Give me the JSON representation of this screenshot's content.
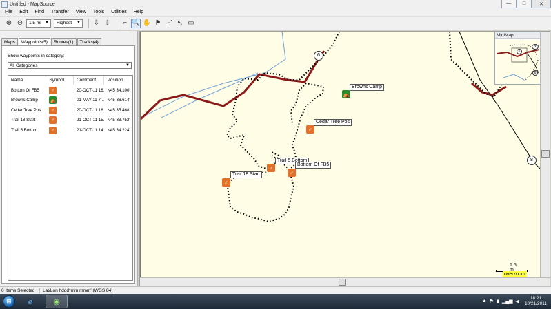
{
  "window": {
    "title": "Untitled - MapSource",
    "minimize": "—",
    "maximize": "□",
    "close": "✕"
  },
  "menu": [
    "File",
    "Edit",
    "Find",
    "Transfer",
    "View",
    "Tools",
    "Utilities",
    "Help"
  ],
  "toolbar": {
    "scale_value": "1.5 mi",
    "detail_value": "Highest"
  },
  "left_panel": {
    "tabs": [
      "Maps",
      "Waypoints(5)",
      "Routes(1)",
      "Tracks(4)"
    ],
    "active_tab": "Waypoints(5)",
    "category_label": "Show waypoints in category:",
    "category_value": "All Categories",
    "columns": [
      "Name",
      "Symbol",
      "Comment",
      "Position"
    ],
    "rows": [
      {
        "name": "Bottom Of FB5",
        "symbol": "bike-icon",
        "comment": "20-OCT-11 16...",
        "position": "N45 34.100'"
      },
      {
        "name": "Browns Camp",
        "symbol": "campground-icon",
        "comment": "01-MAY-11 7:...",
        "position": "N45 36.614'"
      },
      {
        "name": "Cedar Tree Pos",
        "symbol": "bike-icon",
        "comment": "20-OCT-11 16...",
        "position": "N45 35.468'"
      },
      {
        "name": "Trail 18 Start",
        "symbol": "bike-icon",
        "comment": "21-OCT-11 15...",
        "position": "N45 33.752'"
      },
      {
        "name": "Trail 5 Bottom",
        "symbol": "bike-icon",
        "comment": "21-OCT-11 14...",
        "position": "N45 34.224'"
      }
    ]
  },
  "map": {
    "waypoints": {
      "browns_camp": "Browns Camp",
      "cedar_tree_pos": "Cedar Tree Pos",
      "trail_5_bottom": "Trail 5 Bottom",
      "bottom_of_fb5": "Bottom Of FB5",
      "trail_18_start": "Trail 18 Start"
    },
    "road_shields": {
      "top": "6",
      "right": "8"
    },
    "minimap_title": "MiniMap",
    "minimap_shields": {
      "a": "6",
      "b": "26",
      "c": "6"
    },
    "scale_label": "1.5 mi",
    "overzoom": "overzoom"
  },
  "status": {
    "selection": "0 Items Selected",
    "format": "Lat/Lon hddd°mm.mmm' (WGS 84)"
  },
  "taskbar": {
    "time": "18:21",
    "date": "10/21/2011"
  },
  "colors": {
    "map_bg": "#fffde6",
    "road": "#8b1a1a",
    "water": "#6fa0d8",
    "bike_symbol": "#e0702a",
    "camp_symbol": "#2b8a2b"
  }
}
